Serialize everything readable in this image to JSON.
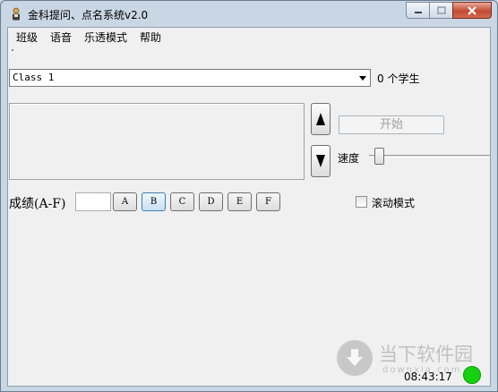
{
  "window": {
    "title": "金科提问、点名系统v2.0",
    "icon": "person-icon"
  },
  "menu": {
    "items": [
      "班级",
      "语音",
      "乐透模式",
      "帮助"
    ]
  },
  "class_select": {
    "value": "Class 1",
    "student_count": "0 个学生"
  },
  "controls": {
    "start_label": "开始",
    "start_enabled": false,
    "up_icon": "arrow-up-icon",
    "down_icon": "arrow-down-icon",
    "speed_label": "速度",
    "speed_level": 0.05
  },
  "grades": {
    "label": "成绩(A-F)",
    "input_value": "",
    "buttons": [
      "A",
      "B",
      "C",
      "D",
      "E",
      "F"
    ]
  },
  "scroll_mode": {
    "label": "滚动模式",
    "checked": false
  },
  "watermark": {
    "text": "当下软件园",
    "sub": "downxia.com"
  },
  "status": {
    "time": "08:43:17",
    "light_color": "#14d20f"
  }
}
